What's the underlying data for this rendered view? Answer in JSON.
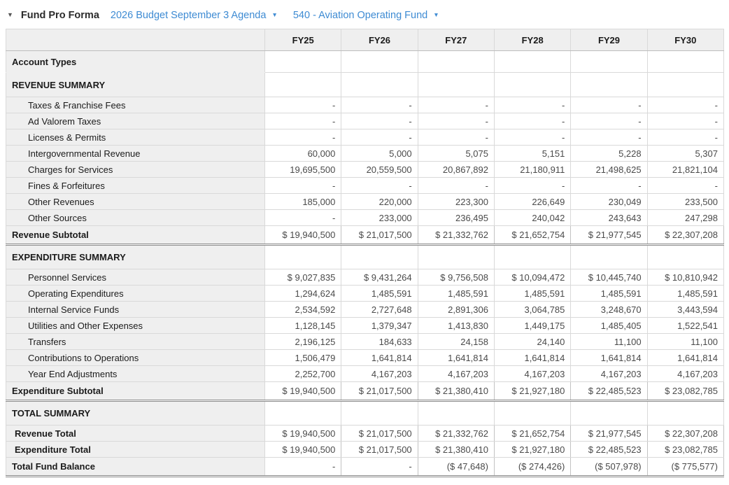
{
  "topbar": {
    "collapse_icon": "▼",
    "title": "Fund Pro Forma",
    "budget_selector": "2026 Budget September 3 Agenda",
    "budget_selector_caret": "▼",
    "fund_selector": "540 - Aviation Operating Fund",
    "fund_selector_caret": "▼"
  },
  "colors": {
    "link_blue": "#3e8bd3",
    "label_column_bg": "#efefef",
    "grid_border": "#d9d9d9",
    "accounting_double_rule": "#8a8a8a"
  },
  "table": {
    "columns": [
      "FY25",
      "FY26",
      "FY27",
      "FY28",
      "FY29",
      "FY30"
    ],
    "rows": [
      {
        "label": "Account Types",
        "style": "blank-header",
        "values": [
          "",
          "",
          "",
          "",
          "",
          ""
        ]
      },
      {
        "label": "REVENUE SUMMARY",
        "style": "section",
        "values": [
          "",
          "",
          "",
          "",
          "",
          ""
        ]
      },
      {
        "label": "Taxes & Franchise Fees",
        "style": "item",
        "values": [
          "-",
          "-",
          "-",
          "-",
          "-",
          "-"
        ]
      },
      {
        "label": "Ad Valorem Taxes",
        "style": "item",
        "values": [
          "-",
          "-",
          "-",
          "-",
          "-",
          "-"
        ]
      },
      {
        "label": "Licenses & Permits",
        "style": "item",
        "values": [
          "-",
          "-",
          "-",
          "-",
          "-",
          "-"
        ]
      },
      {
        "label": "Intergovernmental Revenue",
        "style": "item",
        "values": [
          "60,000",
          "5,000",
          "5,075",
          "5,151",
          "5,228",
          "5,307"
        ]
      },
      {
        "label": "Charges for Services",
        "style": "item",
        "values": [
          "19,695,500",
          "20,559,500",
          "20,867,892",
          "21,180,911",
          "21,498,625",
          "21,821,104"
        ]
      },
      {
        "label": "Fines & Forfeitures",
        "style": "item",
        "values": [
          "-",
          "-",
          "-",
          "-",
          "-",
          "-"
        ]
      },
      {
        "label": "Other Revenues",
        "style": "item",
        "values": [
          "185,000",
          "220,000",
          "223,300",
          "226,649",
          "230,049",
          "233,500"
        ]
      },
      {
        "label": "Other Sources",
        "style": "item",
        "values": [
          "-",
          "233,000",
          "236,495",
          "240,042",
          "243,643",
          "247,298"
        ]
      },
      {
        "label": "Revenue Subtotal",
        "style": "subtotal",
        "values": [
          "$ 19,940,500",
          "$ 21,017,500",
          "$ 21,332,762",
          "$ 21,652,754",
          "$ 21,977,545",
          "$ 22,307,208"
        ]
      },
      {
        "label": "EXPENDITURE SUMMARY",
        "style": "section",
        "values": [
          "",
          "",
          "",
          "",
          "",
          ""
        ]
      },
      {
        "label": "Personnel Services",
        "style": "item",
        "values": [
          "$ 9,027,835",
          "$ 9,431,264",
          "$ 9,756,508",
          "$ 10,094,472",
          "$ 10,445,740",
          "$ 10,810,942"
        ]
      },
      {
        "label": "Operating Expenditures",
        "style": "item",
        "values": [
          "1,294,624",
          "1,485,591",
          "1,485,591",
          "1,485,591",
          "1,485,591",
          "1,485,591"
        ]
      },
      {
        "label": "Internal Service Funds",
        "style": "item",
        "values": [
          "2,534,592",
          "2,727,648",
          "2,891,306",
          "3,064,785",
          "3,248,670",
          "3,443,594"
        ]
      },
      {
        "label": "Utilities and Other Expenses",
        "style": "item",
        "values": [
          "1,128,145",
          "1,379,347",
          "1,413,830",
          "1,449,175",
          "1,485,405",
          "1,522,541"
        ]
      },
      {
        "label": "Transfers",
        "style": "item",
        "values": [
          "2,196,125",
          "184,633",
          "24,158",
          "24,140",
          "11,100",
          "11,100"
        ]
      },
      {
        "label": "Contributions to Operations",
        "style": "item",
        "values": [
          "1,506,479",
          "1,641,814",
          "1,641,814",
          "1,641,814",
          "1,641,814",
          "1,641,814"
        ]
      },
      {
        "label": "Year End Adjustments",
        "style": "item",
        "values": [
          "2,252,700",
          "4,167,203",
          "4,167,203",
          "4,167,203",
          "4,167,203",
          "4,167,203"
        ]
      },
      {
        "label": "Expenditure Subtotal",
        "style": "subtotal",
        "values": [
          "$ 19,940,500",
          "$ 21,017,500",
          "$ 21,380,410",
          "$ 21,927,180",
          "$ 22,485,523",
          "$ 23,082,785"
        ]
      },
      {
        "label": "TOTAL SUMMARY",
        "style": "section",
        "values": [
          "",
          "",
          "",
          "",
          "",
          ""
        ]
      },
      {
        "label": "Revenue Total",
        "style": "total-item",
        "values": [
          "$ 19,940,500",
          "$ 21,017,500",
          "$ 21,332,762",
          "$ 21,652,754",
          "$ 21,977,545",
          "$ 22,307,208"
        ]
      },
      {
        "label": "Expenditure Total",
        "style": "total-item",
        "values": [
          "$ 19,940,500",
          "$ 21,017,500",
          "$ 21,380,410",
          "$ 21,927,180",
          "$ 22,485,523",
          "$ 23,082,785"
        ]
      },
      {
        "label": "Total Fund Balance",
        "style": "grand-total",
        "values": [
          "-",
          "-",
          "($ 47,648)",
          "($ 274,426)",
          "($ 507,978)",
          "($ 775,577)"
        ]
      }
    ]
  }
}
